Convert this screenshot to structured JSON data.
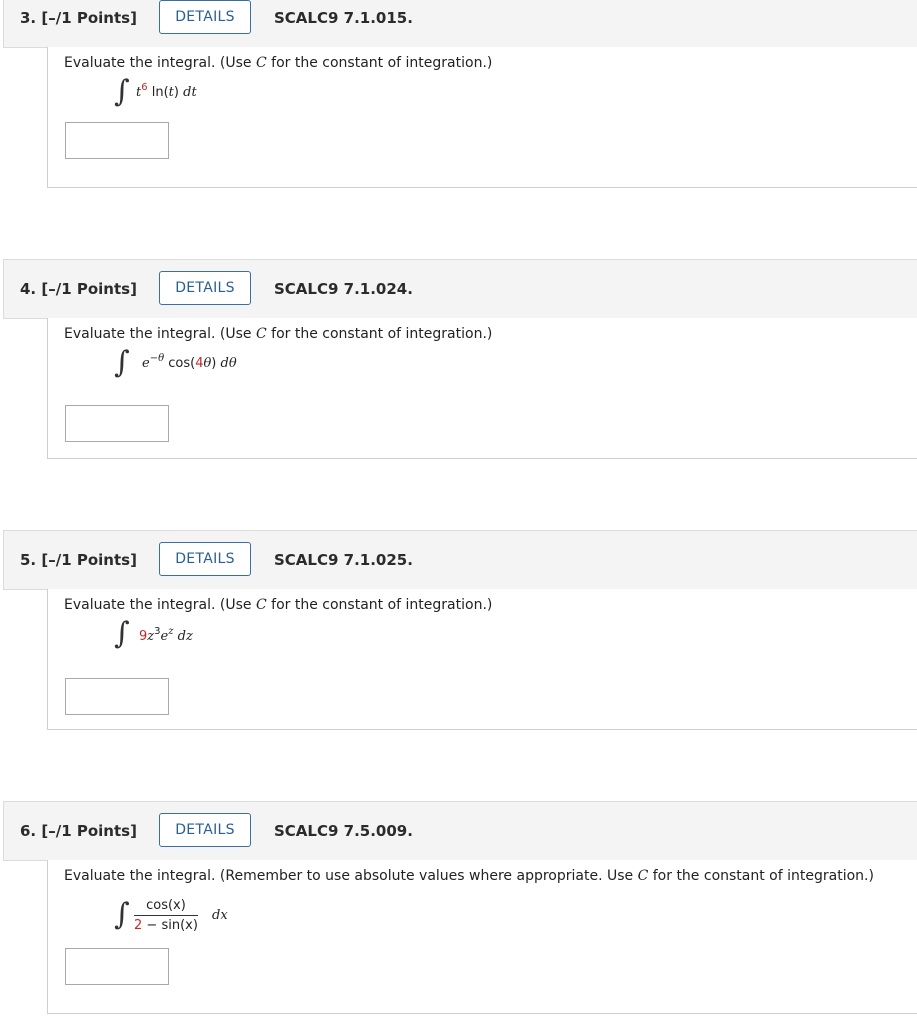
{
  "questions": [
    {
      "number": "3. [–/1 Points]",
      "details_label": "DETAILS",
      "code": "SCALC9 7.1.015.",
      "prompt_a": "Evaluate the integral. (Use ",
      "prompt_c": "C",
      "prompt_b": " for the constant of integration.)",
      "integrand": {
        "base": "t",
        "exp": "6",
        "rest": " ln(",
        "var": "t",
        "close": ") ",
        "d": "dt"
      },
      "answer_value": ""
    },
    {
      "number": "4. [–/1 Points]",
      "details_label": "DETAILS",
      "code": "SCALC9 7.1.024.",
      "prompt_a": "Evaluate the integral. (Use ",
      "prompt_c": "C",
      "prompt_b": " for the constant of integration.)",
      "integrand": {
        "base": "e",
        "exp": "−θ",
        "rest": " cos(",
        "coef": "4",
        "var": "θ",
        "close": ") ",
        "d": "dθ"
      },
      "answer_value": ""
    },
    {
      "number": "5. [–/1 Points]",
      "details_label": "DETAILS",
      "code": "SCALC9 7.1.025.",
      "prompt_a": "Evaluate the integral. (Use ",
      "prompt_c": "C",
      "prompt_b": " for the constant of integration.)",
      "integrand": {
        "coef": "9",
        "base": "z",
        "exp": "3",
        "base2": "e",
        "exp2": "z",
        "d": " dz"
      },
      "answer_value": ""
    },
    {
      "number": "6. [–/1 Points]",
      "details_label": "DETAILS",
      "code": "SCALC9 7.5.009.",
      "prompt_a": "Evaluate the integral. (Remember to use absolute values where appropriate. Use ",
      "prompt_c": "C",
      "prompt_b": " for the constant of integration.)",
      "integrand": {
        "numerator": "cos(x)",
        "den_const": "2",
        "den_rest": " − sin(x)",
        "d": "dx"
      },
      "answer_value": ""
    }
  ]
}
